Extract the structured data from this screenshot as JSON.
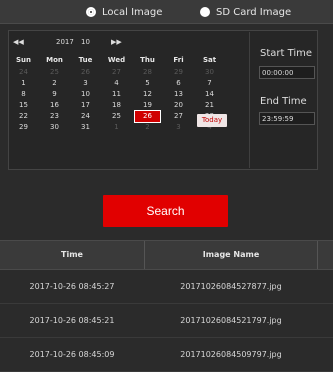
{
  "source_tabs": [
    {
      "label": "Local Image",
      "selected": true
    },
    {
      "label": "SD Card Image",
      "selected": false
    }
  ],
  "calendar": {
    "prev_year_icon": "double-left-arrow",
    "year": "2017",
    "month": "10",
    "next_month_icon": "double-right-arrow",
    "weekdays": [
      "Sun",
      "Mon",
      "Tue",
      "Wed",
      "Thu",
      "Fri",
      "Sat"
    ],
    "weeks": [
      [
        "24",
        "25",
        "26",
        "27",
        "28",
        "29",
        "30"
      ],
      [
        "1",
        "2",
        "3",
        "4",
        "5",
        "6",
        "7"
      ],
      [
        "8",
        "9",
        "10",
        "11",
        "12",
        "13",
        "14"
      ],
      [
        "15",
        "16",
        "17",
        "18",
        "19",
        "20",
        "21"
      ],
      [
        "22",
        "23",
        "24",
        "25",
        "26",
        "27",
        "28"
      ],
      [
        "29",
        "30",
        "31",
        "1",
        "2",
        "3",
        "4"
      ]
    ],
    "selected_day": "26",
    "today_label": "Today",
    "accent_color": "#d00000"
  },
  "range": {
    "start_label": "Start Time",
    "start_value": "00:00:00",
    "end_label": "End Time",
    "end_value": "23:59:59"
  },
  "search_label": "Search",
  "table": {
    "columns": [
      "Time",
      "Image Name"
    ],
    "rows": [
      {
        "time": "2017-10-26 08:45:27",
        "name": "20171026084527877.jpg"
      },
      {
        "time": "2017-10-26 08:45:21",
        "name": "20171026084521797.jpg"
      },
      {
        "time": "2017-10-26 08:45:09",
        "name": "20171026084509797.jpg"
      }
    ]
  }
}
